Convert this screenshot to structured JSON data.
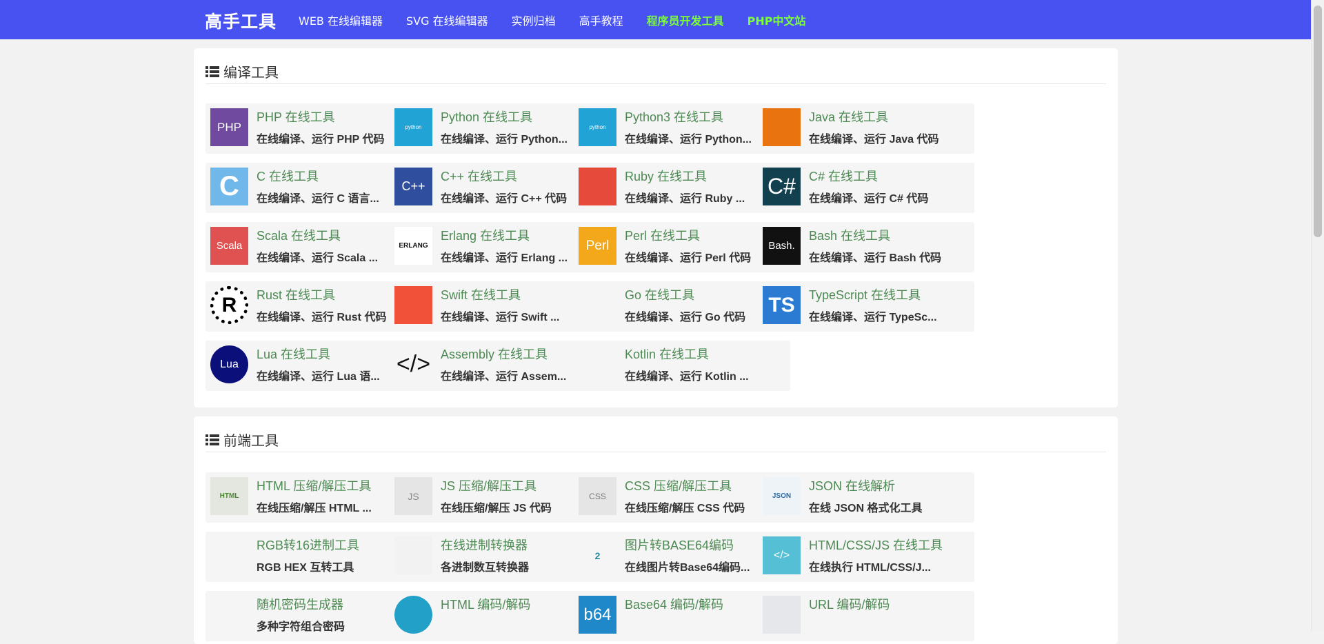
{
  "nav": {
    "brand": "高手工具",
    "items": [
      {
        "label": "WEB 在线编辑器"
      },
      {
        "label": "SVG 在线编辑器"
      },
      {
        "label": "实例归档"
      },
      {
        "label": "高手教程"
      },
      {
        "label": "程序员开发工具"
      },
      {
        "label": "PHP中文站"
      }
    ]
  },
  "compile": {
    "title": "编译工具",
    "tools": [
      {
        "title": "PHP 在线工具",
        "desc": "在线编译、运行 PHP 代码",
        "icon": "php-icon",
        "icon_text": "PHP"
      },
      {
        "title": "Python 在线工具",
        "desc": "在线编译、运行 Python...",
        "icon": "python-icon",
        "icon_text": "python"
      },
      {
        "title": "Python3 在线工具",
        "desc": "在线编译、运行 Python...",
        "icon": "python-icon",
        "icon_text": "python"
      },
      {
        "title": "Java 在线工具",
        "desc": "在线编译、运行 Java 代码",
        "icon": "java-icon",
        "icon_text": ""
      },
      {
        "title": "C 在线工具",
        "desc": "在线编译、运行 C 语言...",
        "icon": "c-icon",
        "icon_text": "C"
      },
      {
        "title": "C++ 在线工具",
        "desc": "在线编译、运行 C++ 代码",
        "icon": "cpp-icon",
        "icon_text": "C++"
      },
      {
        "title": "Ruby 在线工具",
        "desc": "在线编译、运行 Ruby ...",
        "icon": "ruby-icon",
        "icon_text": ""
      },
      {
        "title": "C# 在线工具",
        "desc": "在线编译、运行 C# 代码",
        "icon": "csharp-icon",
        "icon_text": "C#"
      },
      {
        "title": "Scala 在线工具",
        "desc": "在线编译、运行 Scala ...",
        "icon": "scala-icon",
        "icon_text": "Scala"
      },
      {
        "title": "Erlang 在线工具",
        "desc": "在线编译、运行 Erlang ...",
        "icon": "erlang-icon",
        "icon_text": "ERLANG"
      },
      {
        "title": "Perl 在线工具",
        "desc": "在线编译、运行 Perl 代码",
        "icon": "perl-icon",
        "icon_text": "Perl"
      },
      {
        "title": "Bash 在线工具",
        "desc": "在线编译、运行 Bash 代码",
        "icon": "bash-icon",
        "icon_text": "Bash."
      },
      {
        "title": "Rust 在线工具",
        "desc": "在线编译、运行 Rust 代码",
        "icon": "rust-icon",
        "icon_text": "R"
      },
      {
        "title": "Swift 在线工具",
        "desc": "在线编译、运行 Swift ...",
        "icon": "swift-icon",
        "icon_text": ""
      },
      {
        "title": "Go 在线工具",
        "desc": "在线编译、运行 Go 代码",
        "icon": "go-icon",
        "icon_text": ""
      },
      {
        "title": "TypeScript 在线工具",
        "desc": "在线编译、运行 TypeSc...",
        "icon": "typescript-icon",
        "icon_text": "TS"
      },
      {
        "title": "Lua 在线工具",
        "desc": "在线编译、运行 Lua 语...",
        "icon": "lua-icon",
        "icon_text": "Lua"
      },
      {
        "title": "Assembly 在线工具",
        "desc": "在线编译、运行 Assem...",
        "icon": "code-icon",
        "icon_text": "</>"
      },
      {
        "title": "Kotlin 在线工具",
        "desc": "在线编译、运行 Kotlin ...",
        "icon": "kotlin-icon",
        "icon_text": ""
      }
    ]
  },
  "frontend": {
    "title": "前端工具",
    "tools": [
      {
        "title": "HTML 压缩/解压工具",
        "desc": "在线压缩/解压 HTML ...",
        "icon": "html-file-icon",
        "icon_text": "HTML"
      },
      {
        "title": "JS 压缩/解压工具",
        "desc": "在线压缩/解压 JS 代码",
        "icon": "js-file-icon",
        "icon_text": "JS"
      },
      {
        "title": "CSS 压缩/解压工具",
        "desc": "在线压缩/解压 CSS 代码",
        "icon": "css-file-icon",
        "icon_text": "CSS"
      },
      {
        "title": "JSON 在线解析",
        "desc": "在线 JSON 格式化工具",
        "icon": "json-file-icon",
        "icon_text": "JSON"
      },
      {
        "title": "RGB转16进制工具",
        "desc": "RGB HEX 互转工具",
        "icon": "rgb-cubes-icon",
        "icon_text": ""
      },
      {
        "title": "在线进制转换器",
        "desc": "各进制数互转换器",
        "icon": "binary-icon",
        "icon_text": ""
      },
      {
        "title": "图片转BASE64编码",
        "desc": "在线图片转Base64编码...",
        "icon": "gears-icon",
        "icon_text": "2"
      },
      {
        "title": "HTML/CSS/JS 在线工具",
        "desc": "在线执行 HTML/CSS/J...",
        "icon": "browser-code-icon",
        "icon_text": "</>"
      },
      {
        "title": "随机密码生成器",
        "desc": "多种字符组合密码",
        "icon": "key-icon",
        "icon_text": ""
      },
      {
        "title": "HTML 编码/解码",
        "desc": "",
        "icon": "monitor-icon",
        "icon_text": ""
      },
      {
        "title": "Base64 编码/解码",
        "desc": "",
        "icon": "base64-icon",
        "icon_text": "b64"
      },
      {
        "title": "URL 编码/解码",
        "desc": "",
        "icon": "url-icon",
        "icon_text": ""
      }
    ]
  },
  "colors": {
    "nav_bg": "#4752f0",
    "nav_highlight": "#7dff3a",
    "title_green": "#4d8a53"
  }
}
